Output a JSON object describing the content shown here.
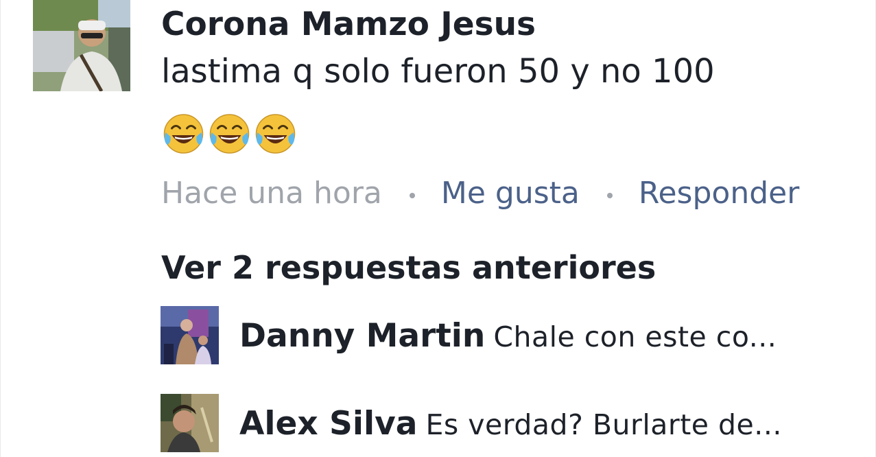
{
  "comment": {
    "author": "Corona Mamzo Jesus",
    "text": "lastima q solo fueron 50 y no 100",
    "emojis": [
      "face-with-tears-of-joy-icon",
      "face-with-tears-of-joy-icon",
      "face-with-tears-of-joy-icon"
    ],
    "time": "Hace una hora",
    "like_label": "Me gusta",
    "reply_label": "Responder"
  },
  "replies": {
    "view_previous": "Ver 2 respuestas anteriores",
    "items": [
      {
        "author": "Danny Martin",
        "text": "Chale con este co..."
      },
      {
        "author": "Alex Silva",
        "text": "Es verdad? Burlarte de..."
      }
    ]
  },
  "colors": {
    "text": "#1d2129",
    "muted": "#a0a4ab",
    "link": "#4b6189"
  }
}
